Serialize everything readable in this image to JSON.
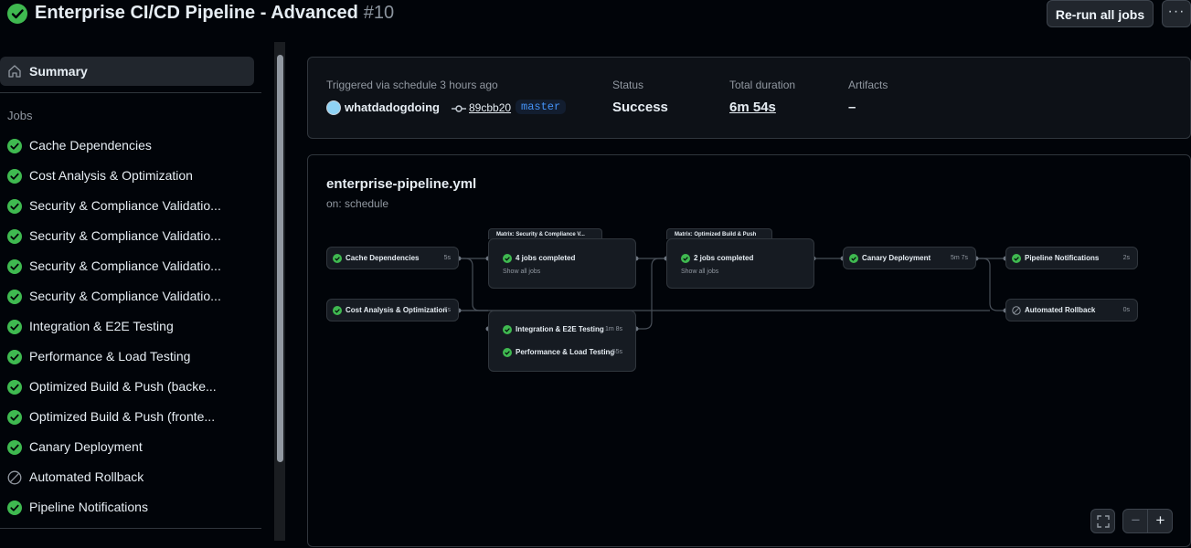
{
  "header": {
    "title": "Enterprise CI/CD Pipeline - Advanced",
    "run_number": "#10",
    "rerun_label": "Re-run all jobs",
    "more_label": "···"
  },
  "sidebar": {
    "summary_label": "Summary",
    "jobs_heading": "Jobs",
    "jobs": [
      {
        "label": "Cache Dependencies",
        "status": "success"
      },
      {
        "label": "Cost Analysis & Optimization",
        "status": "success"
      },
      {
        "label": "Security & Compliance Validatio...",
        "status": "success"
      },
      {
        "label": "Security & Compliance Validatio...",
        "status": "success"
      },
      {
        "label": "Security & Compliance Validatio...",
        "status": "success"
      },
      {
        "label": "Security & Compliance Validatio...",
        "status": "success"
      },
      {
        "label": "Integration & E2E Testing",
        "status": "success"
      },
      {
        "label": "Performance & Load Testing",
        "status": "success"
      },
      {
        "label": "Optimized Build & Push (backe...",
        "status": "success"
      },
      {
        "label": "Optimized Build & Push (fronte...",
        "status": "success"
      },
      {
        "label": "Canary Deployment",
        "status": "success"
      },
      {
        "label": "Automated Rollback",
        "status": "skipped"
      },
      {
        "label": "Pipeline Notifications",
        "status": "success"
      }
    ]
  },
  "summary": {
    "trigger_text": "Triggered via schedule 3 hours ago",
    "author": "whatdadogdoing",
    "commit": "89cbb20",
    "branch": "master",
    "status_label": "Status",
    "status_value": "Success",
    "duration_label": "Total duration",
    "duration_value": "6m 54s",
    "artifacts_label": "Artifacts",
    "artifacts_value": "–"
  },
  "graph": {
    "workflow_file": "enterprise-pipeline.yml",
    "trigger": "on: schedule",
    "nodes": {
      "cache": {
        "label": "Cache Dependencies",
        "duration": "5s"
      },
      "cost": {
        "label": "Cost Analysis & Optimization",
        "duration": "7s"
      },
      "matrix_security": {
        "title": "Matrix: Security & Compliance V...",
        "label": "4 jobs completed",
        "sub": "Show all jobs"
      },
      "integration": {
        "label": "Integration & E2E Testing",
        "duration": "1m 8s"
      },
      "performance": {
        "label": "Performance & Load Testing",
        "duration": "55s"
      },
      "matrix_build": {
        "title": "Matrix: Optimized Build & Push",
        "label": "2 jobs completed",
        "sub": "Show all jobs"
      },
      "canary": {
        "label": "Canary Deployment",
        "duration": "5m 7s"
      },
      "notifications": {
        "label": "Pipeline Notifications",
        "duration": "2s"
      },
      "rollback": {
        "label": "Automated Rollback",
        "duration": "0s"
      }
    }
  },
  "zoom": {
    "fullscreen_icon": "fullscreen-icon",
    "zoom_out": "−",
    "zoom_in": "+"
  },
  "colors": {
    "success": "#3fb950",
    "bg": "#010409",
    "card": "#0d1117",
    "border": "#30363d",
    "link": "#4493f8"
  }
}
